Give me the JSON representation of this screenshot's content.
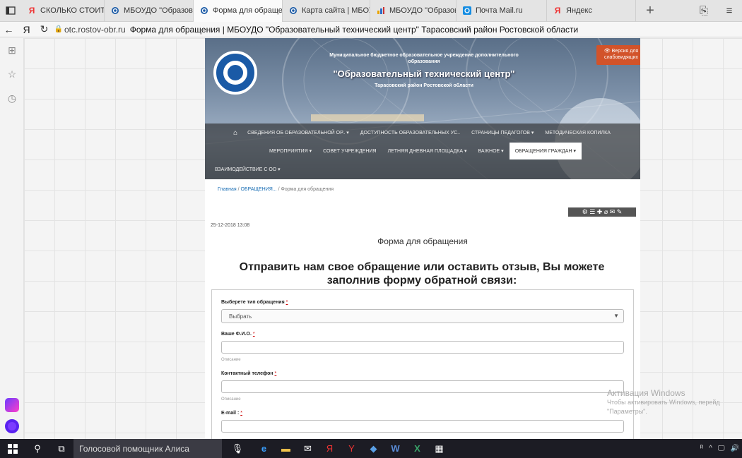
{
  "browser": {
    "tabs": [
      {
        "label": "СКОЛЬКО СТОИТ ТЕТР",
        "icon": "yandex-icon",
        "active": false
      },
      {
        "label": "МБОУДО \"Образовате",
        "icon": "site-logo-icon",
        "active": false
      },
      {
        "label": "Форма для обраще",
        "icon": "site-logo-icon",
        "active": true
      },
      {
        "label": "Карта сайта | МБОУДО",
        "icon": "site-logo-icon",
        "active": false
      },
      {
        "label": "МБОУДО \"Образовате",
        "icon": "chart-icon",
        "active": false
      },
      {
        "label": "Почта Mail.ru",
        "icon": "mail-icon",
        "active": false
      },
      {
        "label": "Яндекс",
        "icon": "yandex-icon",
        "active": false
      }
    ],
    "new_tab": "+",
    "tab_close": "✕",
    "address": {
      "domain": "otc.rostov-obr.ru",
      "page_title": "Форма для обращения | МБОУДО \"Образовательный технический центр\" Тарасовский район Ростовской области"
    }
  },
  "site": {
    "header": {
      "line1": "Муниципальное бюджетное образовательное учреждение дополнительного образования",
      "name": "\"Образовательный технический центр\"",
      "region": "Тарасовский район Ростовской области",
      "vision_button": "👁 Версия для слабовидящих"
    },
    "menu": {
      "row1": [
        "СВЕДЕНИЯ ОБ ОБРАЗОВАТЕЛЬНОЙ ОР.. ▾",
        "ДОСТУПНОСТЬ ОБРАЗОВАТЕЛЬНЫХ УС..",
        "СТРАНИЦЫ ПЕДАГОГОВ ▾",
        "МЕТОДИЧЕСКАЯ КОПИЛКА"
      ],
      "row2": [
        "МЕРОПРИЯТИЯ ▾",
        "СОВЕТ УЧРЕЖДЕНИЯ",
        "ЛЕТНЯЯ ДНЕВНАЯ ПЛОЩАДКА ▾",
        "ВАЖНОЕ ▾",
        "ОБРАЩЕНИЯ ГРАЖДАН ▾"
      ],
      "row3": [
        "ВЗАИМОДЕЙСТВИЕ С ОО ▾"
      ]
    },
    "breadcrumb": {
      "home": "Главная",
      "sep": "/",
      "section": "ОБРАЩЕНИЯ...",
      "current": "Форма для обращения"
    },
    "toolbar_icons": "⚙ ☰ ✚ ⌀ ✉ ✎",
    "date": "25-12-2018 13:08",
    "form_title": "Форма для обращения",
    "intro": "Отправить нам свое обращение или оставить отзыв, Вы можете заполнив форму обратной связи:",
    "form": {
      "type_label": "Выберете тип обращения",
      "required_mark": "*",
      "type_value": "Выбрать",
      "name_label": "Ваше Ф.И.О.",
      "name_hint": "Описание",
      "phone_label": "Контактный телефон",
      "phone_hint": "Описание",
      "email_label": "E-mail :"
    }
  },
  "watermark": {
    "title": "Активация Windows",
    "line1": "Чтобы активировать Windows, перейд",
    "line2": "\"Параметры\"."
  },
  "taskbar": {
    "alice": "Голосовой помощник Алиса",
    "tray": [
      "ᴿ",
      "^",
      "🖵",
      "🔊"
    ]
  },
  "colors": {
    "accent": "#d2532a",
    "link": "#1b6fb5",
    "taskbar": "#1c1c24"
  }
}
